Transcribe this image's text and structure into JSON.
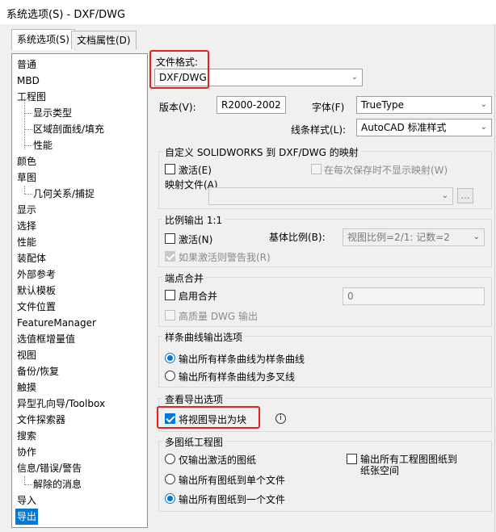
{
  "window": {
    "title": "系统选项(S) - DXF/DWG"
  },
  "tabs": [
    {
      "label": "系统选项(S)",
      "active": true
    },
    {
      "label": "文档属性(D)",
      "active": false
    }
  ],
  "tree": {
    "items": [
      {
        "label": "普通"
      },
      {
        "label": "MBD"
      },
      {
        "label": "工程图"
      },
      {
        "label": "显示类型"
      },
      {
        "label": "区域剖面线/填充"
      },
      {
        "label": "性能"
      },
      {
        "label": "颜色"
      },
      {
        "label": "草图"
      },
      {
        "label": "几何关系/捕捉"
      },
      {
        "label": "显示"
      },
      {
        "label": "选择"
      },
      {
        "label": "性能"
      },
      {
        "label": "装配体"
      },
      {
        "label": "外部参考"
      },
      {
        "label": "默认模板"
      },
      {
        "label": "文件位置"
      },
      {
        "label": "FeatureManager"
      },
      {
        "label": "选值框增量值"
      },
      {
        "label": "视图"
      },
      {
        "label": "备份/恢复"
      },
      {
        "label": "触摸"
      },
      {
        "label": "异型孔向导/Toolbox"
      },
      {
        "label": "文件探索器"
      },
      {
        "label": "搜索"
      },
      {
        "label": "协作"
      },
      {
        "label": "信息/错误/警告"
      },
      {
        "label": "解除的消息"
      },
      {
        "label": "导入"
      },
      {
        "label": "导出"
      }
    ],
    "selected": "导出"
  },
  "file_format": {
    "label": "文件格式:",
    "value": "DXF/DWG"
  },
  "version": {
    "label": "版本(V):",
    "value": "R2000-2002"
  },
  "font": {
    "label": "字体(F)",
    "value": "TrueType"
  },
  "linestyle": {
    "label": "线条样式(L):",
    "value": "AutoCAD 标准样式"
  },
  "custom_map": {
    "title": "自定义 SOLIDWORKS 到 DXF/DWG 的映射",
    "activate_label": "激活(E)",
    "no_show_label": "在每次保存时不显示映射(W)",
    "map_file_label": "映射文件(A)",
    "map_file_value": "",
    "browse_label": "..."
  },
  "scale": {
    "title": "比例输出 1:1",
    "activate_label": "激活(N)",
    "base_label": "基体比例(B):",
    "base_value": "视图比例=2/1: 记数=2",
    "warn_label": "如果激活则警告我(R)"
  },
  "endpoint": {
    "title": "端点合并",
    "merge_label": "启用合并",
    "merge_value": "0",
    "hq_label": "高质量 DWG 输出"
  },
  "spline": {
    "title": "样条曲线输出选项",
    "opt1": "输出所有样条曲线为样条曲线",
    "opt2": "输出所有样条曲线为多叉线"
  },
  "view_export": {
    "title": "查看导出选项",
    "block_label": "将视图导出为块",
    "info_icon": "i"
  },
  "multi_sheet": {
    "title": "多图纸工程图",
    "opt1": "仅输出激活的图纸",
    "opt2": "输出所有图纸到单个文件",
    "opt3": "输出所有图纸到一个文件",
    "paper_line1": "输出所有工程图图纸到",
    "paper_line2": "纸张空间"
  },
  "colors": {
    "accent": "#0078d7",
    "highlight_box": "#e32222"
  }
}
